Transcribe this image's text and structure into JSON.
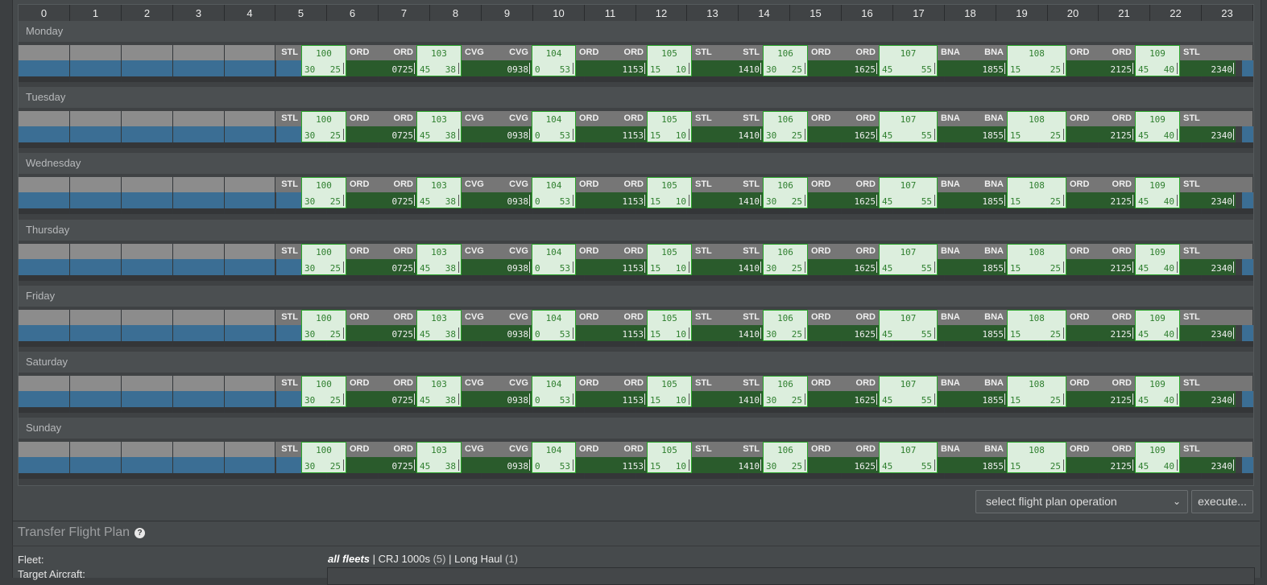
{
  "hours": [
    "0",
    "1",
    "2",
    "3",
    "4",
    "5",
    "6",
    "7",
    "8",
    "9",
    "10",
    "11",
    "12",
    "13",
    "14",
    "15",
    "16",
    "17",
    "18",
    "19",
    "20",
    "21",
    "22",
    "23"
  ],
  "days": [
    "Monday",
    "Tuesday",
    "Wednesday",
    "Thursday",
    "Friday",
    "Saturday",
    "Sunday"
  ],
  "schedule": {
    "first_departure_airport": "STL",
    "flights": [
      {
        "number": "100",
        "left_value": "30",
        "right_value": "25"
      },
      {
        "number": "103",
        "left_value": "45",
        "right_value": "38"
      },
      {
        "number": "104",
        "left_value": "0",
        "right_value": "53"
      },
      {
        "number": "105",
        "left_value": "15",
        "right_value": "10"
      },
      {
        "number": "106",
        "left_value": "30",
        "right_value": "25"
      },
      {
        "number": "107",
        "left_value": "45",
        "right_value": "55"
      },
      {
        "number": "108",
        "left_value": "15",
        "right_value": "25"
      },
      {
        "number": "109",
        "left_value": "45",
        "right_value": "40"
      }
    ],
    "ground_stops": [
      {
        "arrival_airport": "ORD",
        "departure_airport": "ORD",
        "time": "0725"
      },
      {
        "arrival_airport": "CVG",
        "departure_airport": "CVG",
        "time": "0938"
      },
      {
        "arrival_airport": "ORD",
        "departure_airport": "ORD",
        "time": "1153"
      },
      {
        "arrival_airport": "STL",
        "departure_airport": "STL",
        "time": "1410"
      },
      {
        "arrival_airport": "ORD",
        "departure_airport": "ORD",
        "time": "1625"
      },
      {
        "arrival_airport": "BNA",
        "departure_airport": "BNA",
        "time": "1855"
      },
      {
        "arrival_airport": "ORD",
        "departure_airport": "ORD",
        "time": "2125"
      },
      {
        "arrival_airport": "STL",
        "departure_airport": "",
        "time": "2340"
      }
    ]
  },
  "controls": {
    "operation_select_value": "select flight plan operation",
    "execute_label": "execute..."
  },
  "transfer": {
    "title": "Transfer Flight Plan",
    "help_icon": "?",
    "fleet_label": "Fleet:",
    "target_label": "Target Aircraft:",
    "fleets": [
      {
        "name": "all fleets",
        "count": ""
      },
      {
        "name": "CRJ 1000s",
        "count": "(5)"
      },
      {
        "name": "Long Haul",
        "count": "(1)"
      }
    ]
  }
}
